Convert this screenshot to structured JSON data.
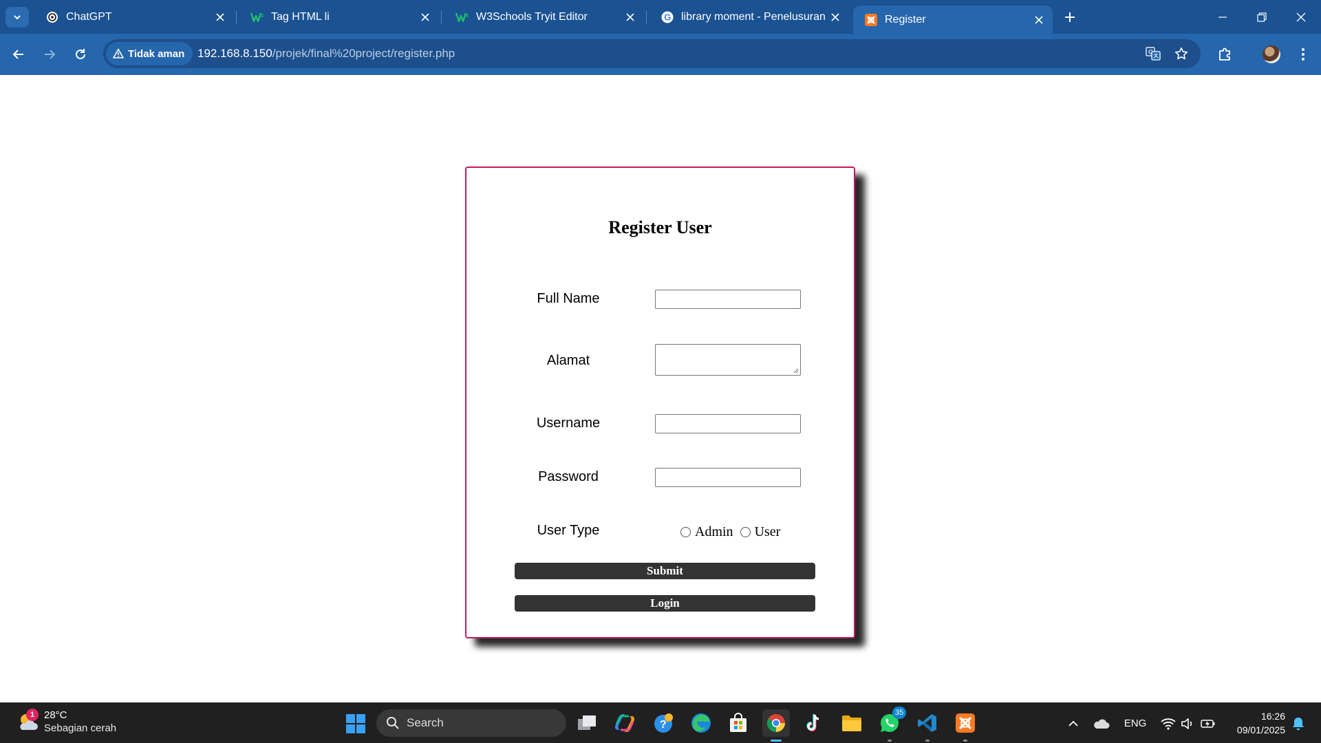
{
  "browser": {
    "tabs": [
      {
        "title": "ChatGPT",
        "icon": "chatgpt-icon"
      },
      {
        "title": "Tag HTML li",
        "icon": "w3schools-icon"
      },
      {
        "title": "W3Schools Tryit Editor",
        "icon": "w3schools-icon"
      },
      {
        "title": "library moment - Penelusuran Google",
        "icon": "google-icon"
      },
      {
        "title": "Register",
        "icon": "xampp-icon",
        "active": true
      }
    ],
    "security_label": "Tidak aman",
    "url_host": "192.168.8.150",
    "url_path": "/projek/final%20project/register.php"
  },
  "form": {
    "title": "Register User",
    "full_name_label": "Full Name",
    "full_name_value": "",
    "alamat_label": "Alamat",
    "alamat_value": "",
    "username_label": "Username",
    "username_value": "",
    "password_label": "Password",
    "password_value": "",
    "user_type_label": "User Type",
    "user_type_options": [
      "Admin",
      "User"
    ],
    "submit_label": "Submit",
    "login_label": "Login"
  },
  "taskbar": {
    "weather_temp": "28°C",
    "weather_desc": "Sebagian cerah",
    "weather_badge": "1",
    "search_placeholder": "Search",
    "whatsapp_badge": "35",
    "language": "ENG",
    "time": "16:26",
    "date": "09/01/2025"
  },
  "colors": {
    "tabbar": "#1a5292",
    "toolbar": "#2566ad",
    "card_border": "#c2185b",
    "button": "#333333",
    "taskbar": "#202020"
  }
}
